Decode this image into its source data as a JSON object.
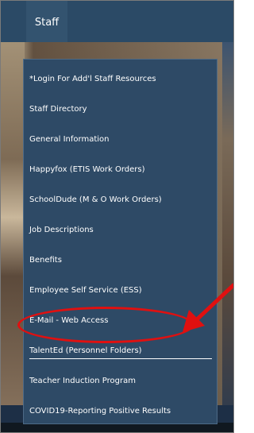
{
  "nav": {
    "tab_label": "Staff"
  },
  "dropdown": {
    "items": [
      {
        "label": "*Login For Add'l Staff Resources"
      },
      {
        "label": "Staff Directory"
      },
      {
        "label": "General Information"
      },
      {
        "label": "Happyfox (ETIS Work Orders)"
      },
      {
        "label": "SchoolDude (M & O Work Orders)"
      },
      {
        "label": "Job Descriptions"
      },
      {
        "label": "Benefits"
      },
      {
        "label": "Employee Self Service (ESS)"
      },
      {
        "label": "E-Mail - Web Access"
      },
      {
        "label": "TalentEd (Personnel Folders)"
      },
      {
        "label": "Teacher Induction Program"
      },
      {
        "label": "COVID19-Reporting Positive Results"
      }
    ]
  },
  "colors": {
    "nav_bar": "#2b4a66",
    "dropdown_bg": "#2e4a66",
    "annotation": "#e01010",
    "text": "#ffffff"
  },
  "icons": {
    "annotation_arrow": "red-arrow-icon",
    "annotation_ellipse": "red-ellipse-highlight"
  }
}
